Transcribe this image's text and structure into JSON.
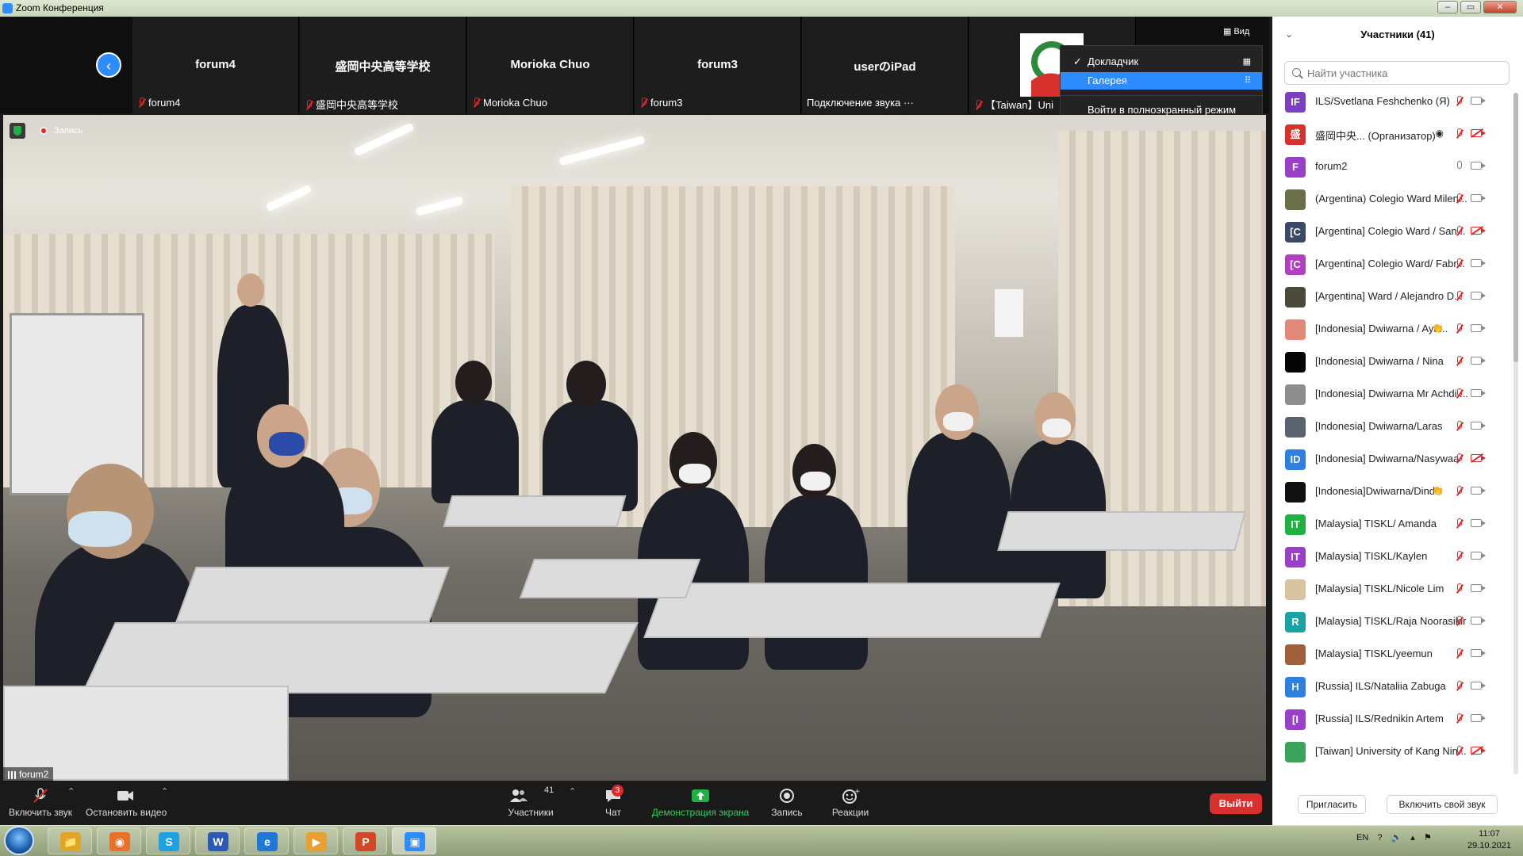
{
  "window": {
    "title": "Zoom Конференция",
    "min": "‒",
    "max": "▭",
    "close": "✕"
  },
  "strip": {
    "tiles": [
      {
        "name": "forum4",
        "label": "forum4",
        "muted": true
      },
      {
        "name": "盛岡中央高等学校",
        "label": "盛岡中央高等学校",
        "muted": true
      },
      {
        "name": "Morioka Chuo",
        "label": "Morioka Chuo",
        "muted": true
      },
      {
        "name": "forum3",
        "label": "forum3",
        "muted": true
      },
      {
        "name": "userのiPad",
        "label": "Подключение звука ···",
        "muted": false
      },
      {
        "name": "",
        "label": "【Taiwan】Uni",
        "muted": true
      }
    ]
  },
  "view_button": "Вид",
  "view_menu": {
    "speaker": "Докладчик",
    "gallery": "Галерея",
    "fullscreen": "Войти в полноэкранный режим"
  },
  "recording": {
    "label": "Запись"
  },
  "active_speaker": "forum2",
  "toolbar": {
    "mute": "Включить звук",
    "video": "Остановить видео",
    "participants": "Участники",
    "participants_count": "41",
    "chat": "Чат",
    "chat_badge": "3",
    "share": "Демонстрация экрана",
    "record": "Запись",
    "reactions": "Реакции",
    "leave": "Выйти"
  },
  "panel": {
    "title": "Участники (41)",
    "search_placeholder": "Найти участника",
    "invite": "Пригласить",
    "unmute_me": "Включить свой звук",
    "participants": [
      {
        "initials": "IF",
        "color": "#7b3fbf",
        "name": "ILS/Svetlana Feshchenko (Я)",
        "mic": "muted",
        "cam": "on"
      },
      {
        "initials": "盛",
        "color": "#d8302d",
        "name": "盛岡中央...   (Организатор)",
        "mic": "muted",
        "cam": "off",
        "emoji": "◉"
      },
      {
        "initials": "F",
        "color": "#9a3fc7",
        "name": "forum2",
        "mic": "on",
        "cam": "on"
      },
      {
        "initials": "",
        "color": "#6b6f4a",
        "name": "(Argentina) Colegio Ward Milen...",
        "mic": "muted",
        "cam": "on"
      },
      {
        "initials": "[C",
        "color": "#394a66",
        "name": "[Argentina] Colegio Ward / San...",
        "mic": "muted",
        "cam": "off"
      },
      {
        "initials": "[C",
        "color": "#b13fbf",
        "name": "[Argentina] Colegio Ward/ Fabr...",
        "mic": "muted",
        "cam": "on"
      },
      {
        "initials": "",
        "color": "#4b4a38",
        "name": "[Argentina] Ward / Alejandro D...",
        "mic": "muted",
        "cam": "on"
      },
      {
        "initials": "",
        "color": "#e28a7a",
        "name": "[Indonesia] Dwiwarna / Aya...",
        "mic": "muted",
        "cam": "on",
        "emoji": "👏"
      },
      {
        "initials": "",
        "color": "#050505",
        "name": "[Indonesia] Dwiwarna / Nina",
        "mic": "muted",
        "cam": "on"
      },
      {
        "initials": "",
        "color": "#8d8d8d",
        "name": "[Indonesia] Dwiwarna Mr Achdi ...",
        "mic": "muted",
        "cam": "on"
      },
      {
        "initials": "",
        "color": "#5a6470",
        "name": "[Indonesia] Dwiwarna/Laras",
        "mic": "muted",
        "cam": "on"
      },
      {
        "initials": "ID",
        "color": "#2d7fe0",
        "name": "[Indonesia] Dwiwarna/Nasywaa",
        "mic": "muted",
        "cam": "off"
      },
      {
        "initials": "",
        "color": "#111111",
        "name": "[Indonesia]Dwiwarna/Dinda",
        "mic": "muted",
        "cam": "on",
        "emoji": "👏"
      },
      {
        "initials": "IT",
        "color": "#1fb141",
        "name": "[Malaysia] TISKL/ Amanda",
        "mic": "muted",
        "cam": "on"
      },
      {
        "initials": "IT",
        "color": "#9a3fc7",
        "name": "[Malaysia] TISKL/Kaylen",
        "mic": "muted",
        "cam": "on"
      },
      {
        "initials": "",
        "color": "#d9c3a0",
        "name": "[Malaysia] TISKL/Nicole Lim",
        "mic": "muted",
        "cam": "on"
      },
      {
        "initials": "R",
        "color": "#1aa3a3",
        "name": "[Malaysia] TISKL/Raja Noorasikir",
        "mic": "muted",
        "cam": "on"
      },
      {
        "initials": "",
        "color": "#a0603a",
        "name": "[Malaysia] TISKL/yeemun",
        "mic": "muted",
        "cam": "on"
      },
      {
        "initials": "H",
        "color": "#2d7fe0",
        "name": "[Russia] ILS/Nataliia Zabuga",
        "mic": "muted",
        "cam": "on"
      },
      {
        "initials": "[I",
        "color": "#9a3fc7",
        "name": "[Russia] ILS/Rednikin Artem",
        "mic": "muted",
        "cam": "on"
      },
      {
        "initials": "",
        "color": "#3aa55a",
        "name": "[Taiwan] University of Kang Nin...",
        "mic": "muted",
        "cam": "off"
      }
    ]
  },
  "taskbar": {
    "apps": [
      "📁",
      "◉",
      "S",
      "W",
      "e",
      "▶",
      "P",
      "▣"
    ],
    "lang": "EN",
    "time": "11:07",
    "date": "29.10.2021"
  }
}
